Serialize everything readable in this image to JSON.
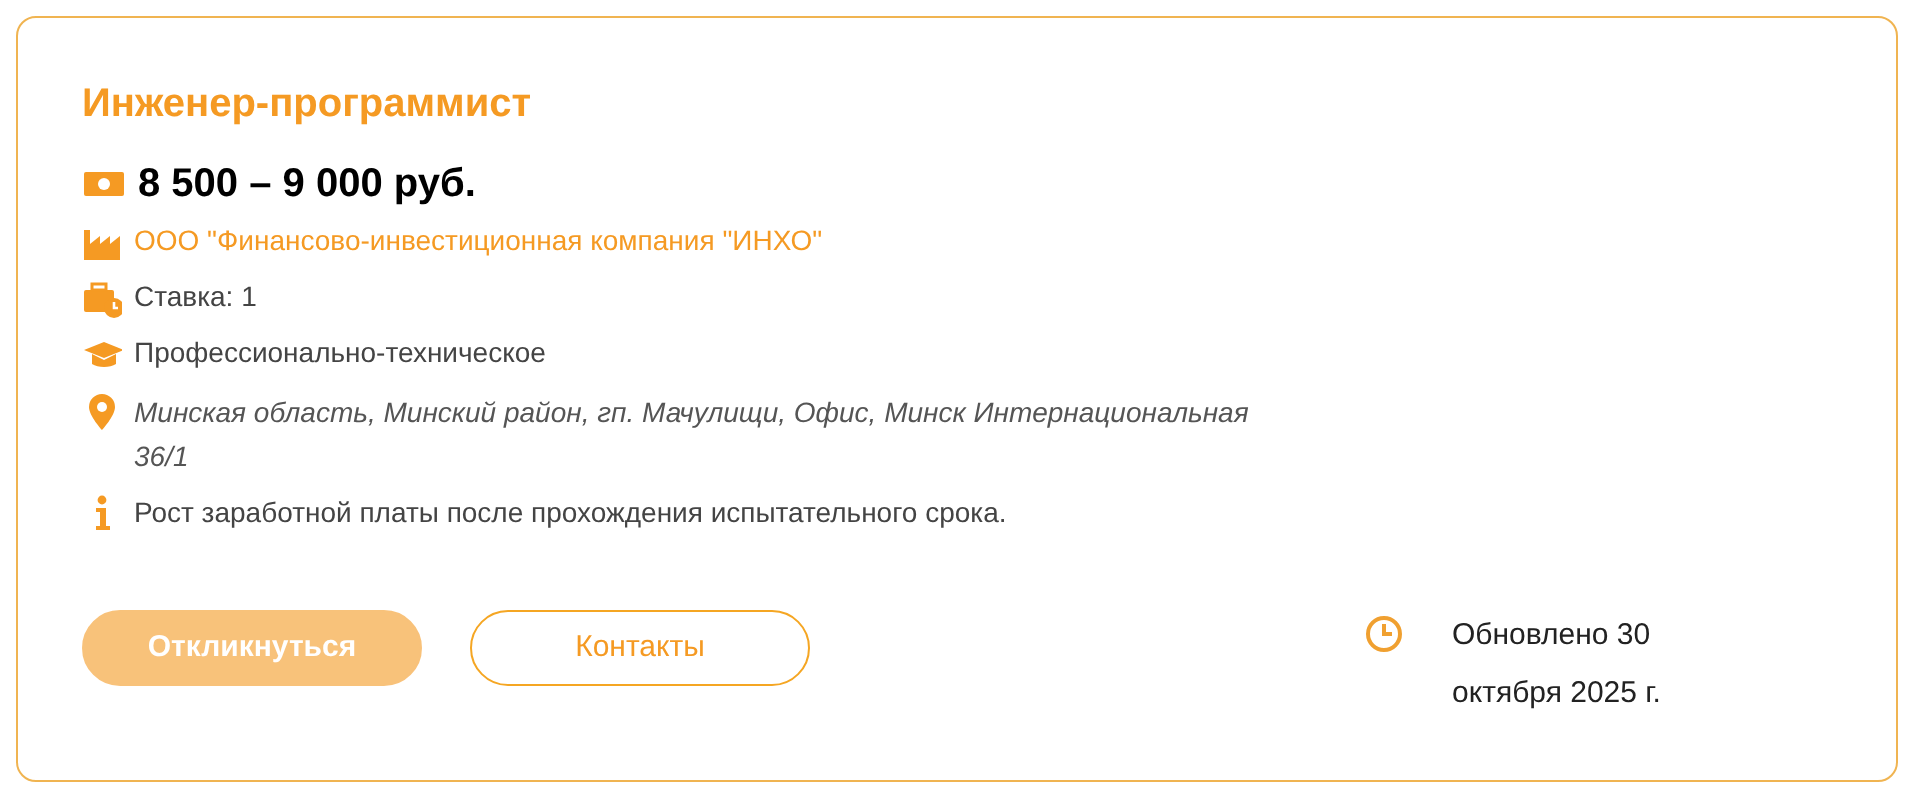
{
  "title": "Инженер-программист",
  "details": [
    {
      "kind": "salary",
      "text": "8 500 – 9 000 руб."
    },
    {
      "kind": "company",
      "text": "ООО \"Финансово-инвестиционная компания \"ИНХО\""
    },
    {
      "kind": "rate",
      "text": "Ставка: 1"
    },
    {
      "kind": "education",
      "text": "Профессионально-техническое"
    },
    {
      "kind": "address",
      "text": "Минская область, Минский район, гп. Мачулищи, Офис, Минск Интернациональная 36/1"
    },
    {
      "kind": "info",
      "text": "Рост заработной платы после прохождения испытательного срока."
    }
  ],
  "buttons": [
    {
      "label": "Откликнуться",
      "kind": "primary",
      "disabled": true
    },
    {
      "label": "Контакты",
      "kind": "outline",
      "disabled": false
    }
  ],
  "updated": "Обновлено 30 октября 2025 г."
}
